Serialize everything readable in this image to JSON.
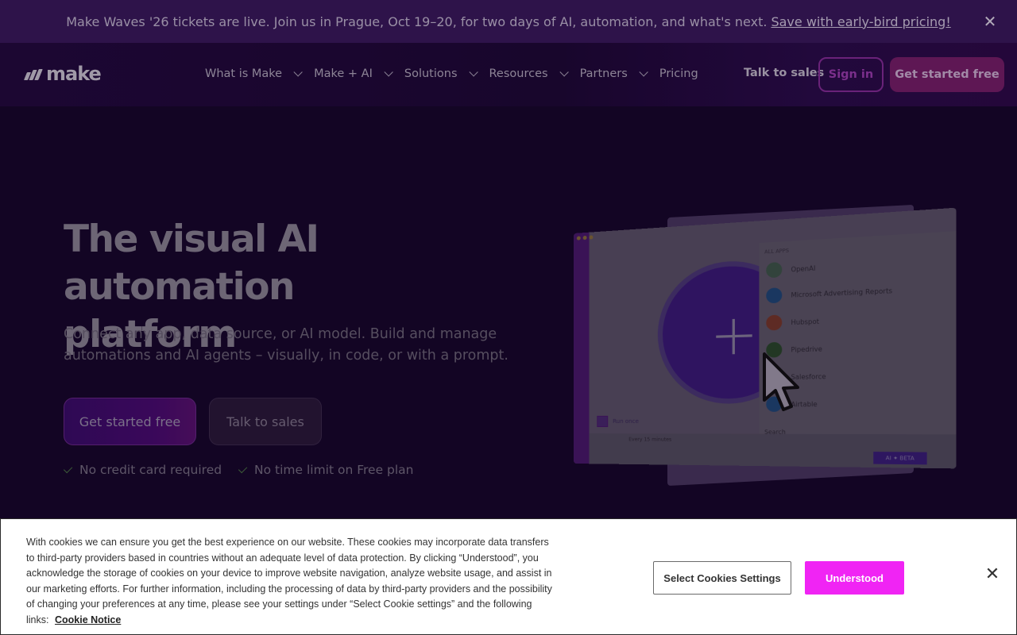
{
  "announcement": {
    "text": "Make Waves '26 tickets are live. Join us in Prague, Oct 19–20, for two days of AI, automation, and what's next.",
    "link": "Save with early-bird pricing!",
    "close_icon": "✕"
  },
  "nav": {
    "logo": "make",
    "items": [
      {
        "label": "What is Make",
        "dropdown": true
      },
      {
        "label": "Make + AI",
        "dropdown": true
      },
      {
        "label": "Solutions",
        "dropdown": true
      },
      {
        "label": "Resources",
        "dropdown": true
      },
      {
        "label": "Partners",
        "dropdown": true
      },
      {
        "label": "Pricing",
        "dropdown": false
      }
    ],
    "talk_to_sales": "Talk to sales",
    "sign_in": "Sign in",
    "cta": "Get started free"
  },
  "hero": {
    "title_line1": "The visual AI automation",
    "title_line2": "platform",
    "subtitle": "Connect any app, data source, or AI model. Build and manage automations and AI agents – visually, in code, or with a prompt.",
    "primary_button": "Get started free",
    "secondary_button": "Talk to sales",
    "checks": [
      "No credit card required",
      "No time limit on Free plan"
    ]
  },
  "mockup": {
    "panel_header": "ALL APPS",
    "apps": [
      {
        "name": "OpenAI",
        "color": "#3f5a4a"
      },
      {
        "name": "Microsoft Advertising Reports",
        "color": "#1f4a7a"
      },
      {
        "name": "Hubspot",
        "color": "#7a3a2a"
      },
      {
        "name": "Pipedrive",
        "color": "#2a4a2a"
      },
      {
        "name": "Salesforce",
        "color": "#1f4a7a"
      },
      {
        "name": "Airtable",
        "color": "#1f4a7a"
      }
    ],
    "search_label": "Search",
    "run_label": "Run once",
    "schedule_label": "Every 15 minutes",
    "ai_label": "AI ✦ BETA"
  },
  "cookie": {
    "text": "With cookies we can ensure you get the best experience on our website. These cookies may incorporate data transfers to third-party providers based in countries without an adequate level of data protection. By clicking “Understood”, you acknowledge the storage of cookies on your device to improve website navigation, analyze website usage, and assist in our marketing efforts. For further information, including the processing of data by third-party providers and the possibility of changing your preferences at any time, please see your settings under “Select Cookie settings” and the following links:",
    "link": "Cookie Notice",
    "settings_button": "Select Cookies Settings",
    "accept_button": "Understood",
    "close_icon": "✕"
  }
}
